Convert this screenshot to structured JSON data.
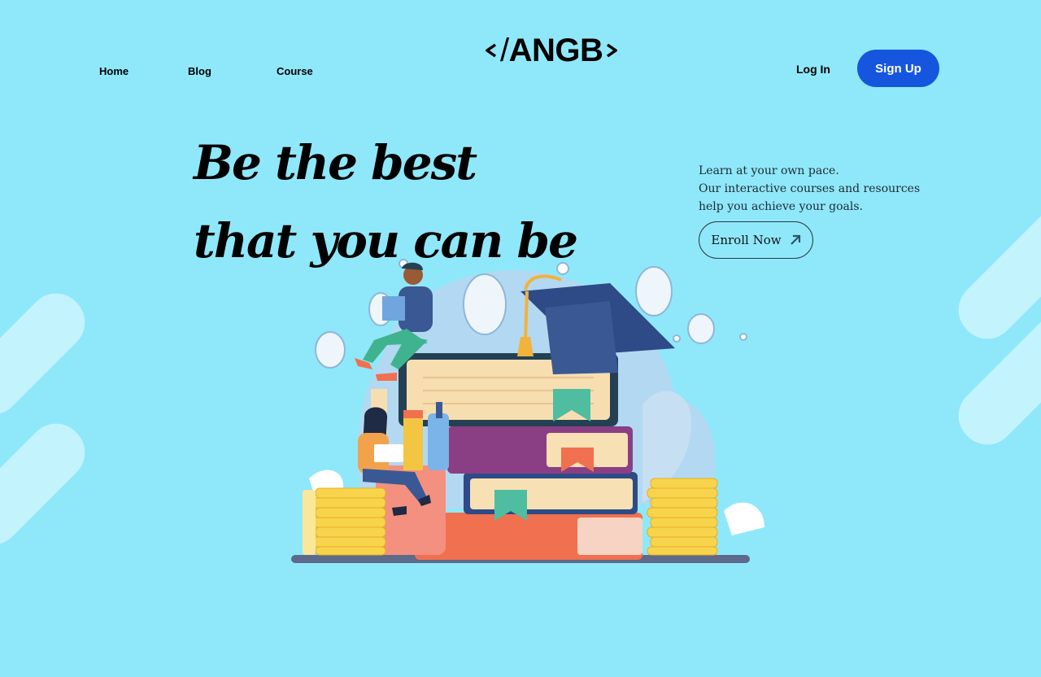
{
  "nav": {
    "links": [
      "Home",
      "Blog",
      "Course"
    ],
    "logo_text": "ANGB",
    "login_label": "Log In",
    "signup_label": "Sign Up"
  },
  "hero": {
    "headline_line1": "Be the best",
    "headline_line2": "that you can be",
    "tagline_lines": [
      "Learn at your own pace.",
      "Our interactive courses and resources",
      "help you achieve your goals."
    ],
    "cta_label": "Enroll Now",
    "cta_icon": "arrow-up-right-icon",
    "illustration": "education-books-illustration"
  },
  "colors": {
    "background": "#8fe8fa",
    "decor": "#c3f3fd",
    "signup_button": "#1656df"
  }
}
